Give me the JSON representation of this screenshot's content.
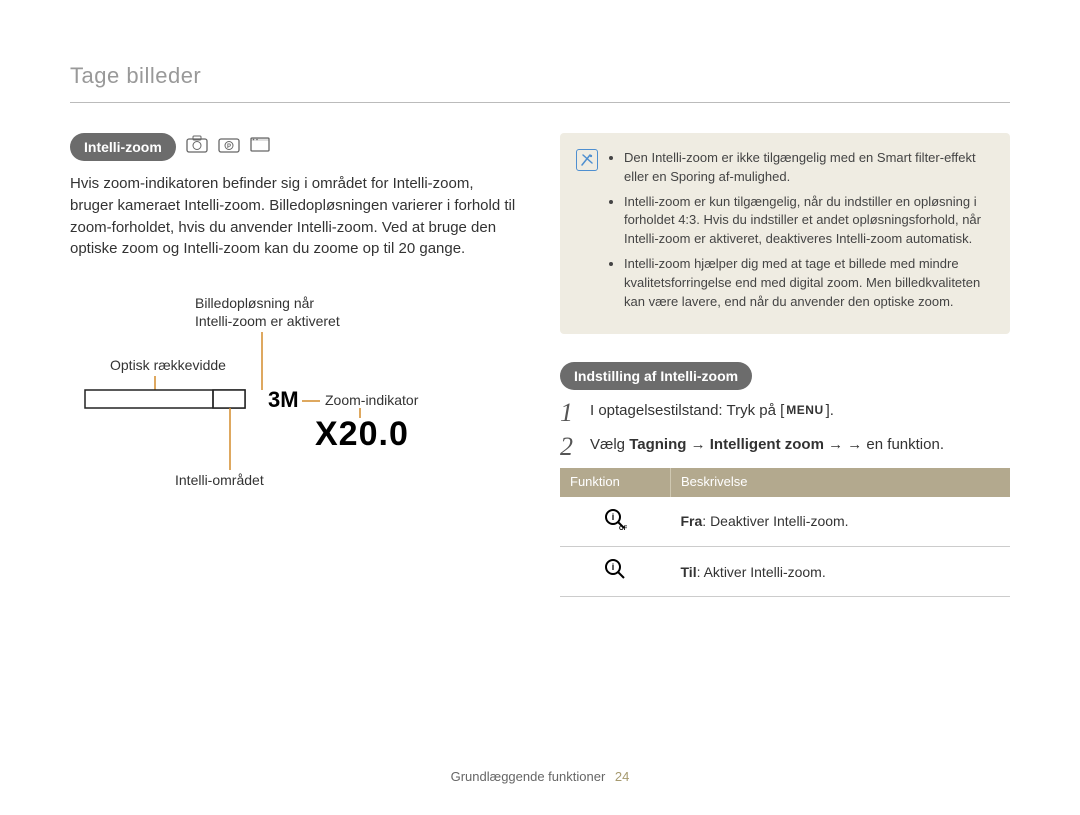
{
  "section_title": "Tage billeder",
  "left": {
    "pill": "Intelli-zoom",
    "body": "Hvis zoom-indikatoren befinder sig i området for Intelli-zoom, bruger kameraet Intelli-zoom. Billedopløsningen varierer i forhold til zoom-forholdet, hvis du anvender Intelli-zoom. Ved at bruge den optiske zoom og Intelli-zoom kan du zoome op til 20 gange.",
    "diagram": {
      "resolution_label_line1": "Billedopløsning når",
      "resolution_label_line2": "Intelli-zoom er aktiveret",
      "optical_range": "Optisk rækkevidde",
      "zoom_indicator": "Zoom-indikator",
      "intelli_area": "Intelli-området",
      "resolution_value": "3M",
      "zoom_value": "X20.0"
    }
  },
  "right": {
    "note_bullets": [
      "Den Intelli-zoom er ikke tilgængelig med en Smart filter-effekt eller en Sporing af-mulighed.",
      "Intelli-zoom er kun tilgængelig, når du indstiller en opløsning i forholdet 4:3. Hvis du indstiller et andet opløsningsforhold, når Intelli-zoom er aktiveret, deaktiveres Intelli-zoom automatisk.",
      "Intelli-zoom hjælper dig med at tage et billede med mindre kvalitetsforringelse end med digital zoom. Men billedkvaliteten kan være lavere, end når du anvender den optiske zoom."
    ],
    "settings_pill": "Indstilling af Intelli-zoom",
    "step1_pre": "I optagelsestilstand: Tryk på [",
    "step1_menu": "MENU",
    "step1_post": "].",
    "step2_pre": "Vælg ",
    "step2_b1": "Tagning",
    "step2_arrow": " → ",
    "step2_b2": "Intelligent zoom",
    "step2_post": " → en funktion.",
    "table": {
      "h_function": "Funktion",
      "h_desc": "Beskrivelse",
      "row_off_label": "Fra",
      "row_off_desc": ": Deaktiver Intelli-zoom.",
      "row_on_label": "Til",
      "row_on_desc": ": Aktiver Intelli-zoom."
    }
  },
  "footer": {
    "text": "Grundlæggende funktioner",
    "page": "24"
  }
}
